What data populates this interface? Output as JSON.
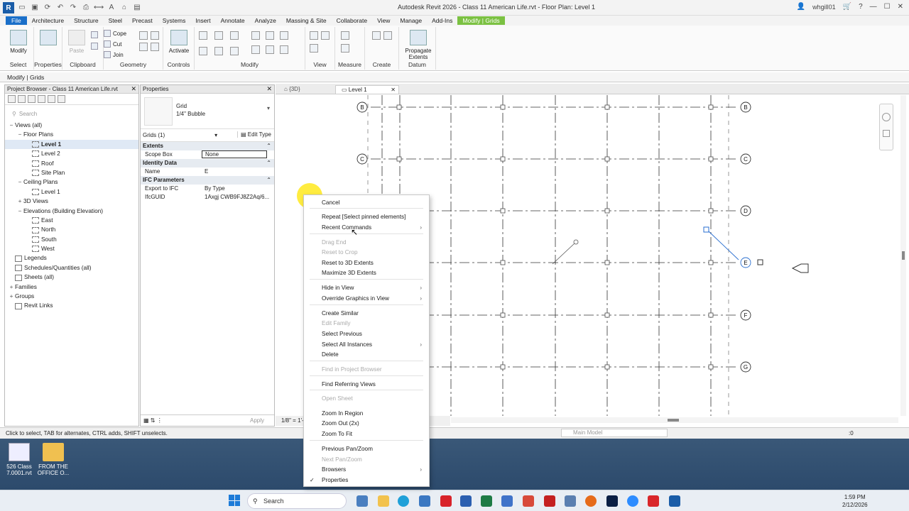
{
  "window": {
    "title": "Autodesk Revit 2026 - Class 11  American Life.rvt - Floor Plan: Level 1",
    "user": "whgill01"
  },
  "ribbon": {
    "tabs": [
      "File",
      "Architecture",
      "Structure",
      "Steel",
      "Precast",
      "Systems",
      "Insert",
      "Annotate",
      "Analyze",
      "Massing & Site",
      "Collaborate",
      "View",
      "Manage",
      "Add-Ins",
      "Modify | Grids"
    ],
    "active_tab": "Modify | Grids",
    "panels": {
      "select": "Select",
      "properties": "Properties",
      "clipboard": "Clipboard",
      "geometry": "Geometry",
      "controls": "Controls",
      "modify": "Modify",
      "view": "View",
      "measure": "Measure",
      "create": "Create",
      "datum": "Datum"
    },
    "buttons": {
      "modify": "Modify",
      "properties": "Properties",
      "paste": "Paste",
      "cope": "Cope",
      "cut": "Cut",
      "join": "Join",
      "activate": "Activate",
      "propagate": "Propagate Extents"
    }
  },
  "options_bar": "Modify | Grids",
  "project_browser": {
    "title": "Project Browser - Class 11  American Life.rvt",
    "search_placeholder": "Search",
    "items": [
      {
        "label": "Views (all)",
        "level": 0,
        "exp": "−"
      },
      {
        "label": "Floor Plans",
        "level": 1,
        "exp": "−"
      },
      {
        "label": "Level 1",
        "level": 2,
        "exp": "",
        "selected": true
      },
      {
        "label": "Level 2",
        "level": 2,
        "exp": ""
      },
      {
        "label": "Roof",
        "level": 2,
        "exp": ""
      },
      {
        "label": "Site Plan",
        "level": 2,
        "exp": ""
      },
      {
        "label": "Ceiling Plans",
        "level": 1,
        "exp": "−"
      },
      {
        "label": "Level 1",
        "level": 2,
        "exp": ""
      },
      {
        "label": "3D Views",
        "level": 1,
        "exp": "+"
      },
      {
        "label": "Elevations (Building Elevation)",
        "level": 1,
        "exp": "−"
      },
      {
        "label": "East",
        "level": 2,
        "exp": ""
      },
      {
        "label": "North",
        "level": 2,
        "exp": ""
      },
      {
        "label": "South",
        "level": 2,
        "exp": ""
      },
      {
        "label": "West",
        "level": 2,
        "exp": ""
      },
      {
        "label": "Legends",
        "level": 0,
        "exp": ""
      },
      {
        "label": "Schedules/Quantities (all)",
        "level": 0,
        "exp": ""
      },
      {
        "label": "Sheets (all)",
        "level": 0,
        "exp": ""
      },
      {
        "label": "Families",
        "level": 0,
        "exp": "+"
      },
      {
        "label": "Groups",
        "level": 0,
        "exp": "+"
      },
      {
        "label": "Revit Links",
        "level": 0,
        "exp": ""
      }
    ]
  },
  "properties": {
    "title": "Properties",
    "type_family": "Grid",
    "type_name": "1/4\" Bubble",
    "filter": "Grids (1)",
    "edit_type": "Edit Type",
    "apply": "Apply",
    "sections": {
      "extents": "Extents",
      "identity": "Identity Data",
      "ifc": "IFC Parameters"
    },
    "rows": {
      "scope_box_k": "Scope Box",
      "scope_box_v": "None",
      "name_k": "Name",
      "name_v": "E",
      "export_k": "Export to IFC",
      "export_v": "By Type",
      "guid_k": "IfcGUID",
      "guid_v": "1Axgj CWB9FJ8Z2Aq/6..."
    }
  },
  "view_tabs": {
    "tab_3d": "{3D}",
    "tab_level1": "Level 1"
  },
  "view_control": {
    "scale": "1/8\" = 1'-"
  },
  "grid_labels": [
    "B",
    "C",
    "D",
    "E",
    "F",
    "G"
  ],
  "context_menu": {
    "items": [
      {
        "label": "Cancel"
      },
      {
        "label": "Repeat [Select pinned elements]"
      },
      {
        "label": "Recent Commands",
        "submenu": true
      },
      {
        "label": "Drag End",
        "disabled": true
      },
      {
        "label": "Reset to Crop",
        "disabled": true
      },
      {
        "label": "Reset to 3D Extents"
      },
      {
        "label": "Maximize 3D Extents"
      },
      {
        "label": "Hide in View",
        "submenu": true
      },
      {
        "label": "Override Graphics in View",
        "submenu": true
      },
      {
        "label": "Create Similar"
      },
      {
        "label": "Edit Family",
        "disabled": true
      },
      {
        "label": "Select Previous"
      },
      {
        "label": "Select All Instances",
        "submenu": true
      },
      {
        "label": "Delete"
      },
      {
        "label": "Find in Project Browser",
        "disabled": true
      },
      {
        "label": "Find Referring Views"
      },
      {
        "label": "Open Sheet",
        "disabled": true
      },
      {
        "label": "Zoom In Region"
      },
      {
        "label": "Zoom Out (2x)"
      },
      {
        "label": "Zoom To Fit"
      },
      {
        "label": "Previous Pan/Zoom"
      },
      {
        "label": "Next Pan/Zoom",
        "disabled": true
      },
      {
        "label": "Browsers",
        "submenu": true
      },
      {
        "label": "Properties",
        "checked": true
      }
    ]
  },
  "status": {
    "hint": "Click to select, TAB for alternates, CTRL adds, SHIFT unselects.",
    "model": "Main Model",
    "filter_count": ":0"
  },
  "desktop": {
    "icon1": "526 Class 7.0001.rvt",
    "icon2": "FROM THE OFFICE O..."
  },
  "taskbar": {
    "search": "Search",
    "time": "1:59 PM",
    "date": "2/12/2026"
  },
  "colors": {
    "file_tab": "#1a6fc9",
    "contextual_tab": "#7bc142",
    "cursor_highlight": "#ffe600"
  }
}
